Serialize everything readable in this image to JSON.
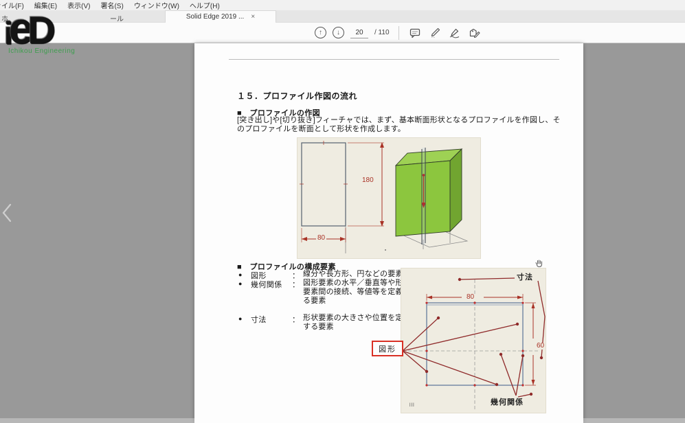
{
  "menu_bar": {
    "items": [
      "ファイル(F)",
      "編集(E)",
      "表示(V)",
      "署名(S)",
      "ウィンドウ(W)",
      "ヘルプ(H)"
    ]
  },
  "tabs": {
    "home_partial": "ホ",
    "tools_partial": "ール",
    "document_tab": "Solid Edge 2019  ...",
    "close_glyph": "×"
  },
  "toolbar": {
    "up_glyph": "↑",
    "down_glyph": "↓",
    "page_current": "20",
    "page_total_label": "/ 110"
  },
  "watermark": {
    "logo_i": "i",
    "logo_e": "e",
    "logo_d": "D",
    "subtitle": "Ichikou Engineering"
  },
  "doc": {
    "heading": "１５．プロファイル作図の流れ",
    "section1_title": "■　プロファイルの作図",
    "section1_body": "[突き出し]や[切り抜き]フィーチャでは、まず、基本断面形状となるプロファイルを作図し、そのプロファイルを断面として形状を作成します。",
    "section2_title": "■　プロファイルの構成要素",
    "bullets": [
      {
        "marker": "●",
        "term": "図形",
        "sep": "：",
        "desc": "線分や長方形、円などの要素"
      },
      {
        "marker": "●",
        "term": "幾何関係",
        "sep": "：",
        "desc": "図形要素の水平／垂直等や形状要素間の接続、等値等を定義する要素"
      },
      {
        "marker": "●",
        "term": "寸法",
        "sep": "：",
        "desc": "形状要素の大きさや位置を定義する要素"
      }
    ],
    "fig1": {
      "dim_height": "180",
      "dim_width": "80"
    },
    "fig2": {
      "dim_width": "80",
      "dim_height": "60",
      "label_dimension": "寸法",
      "label_shape": "図形",
      "label_geometry": "幾何関係",
      "footnote": "lll"
    }
  },
  "colors": {
    "viewer_bg": "#999999",
    "dim_red": "#a93226",
    "annotation_red": "#8f2a2a",
    "sketch_blue": "#6f84a2",
    "figure_bg": "#efece1",
    "model_green_front": "#8cc63e",
    "model_green_top": "#9ed154",
    "model_green_side": "#71a530",
    "shape_box_red": "#d93025",
    "logo_green": "#3f9e4f"
  }
}
